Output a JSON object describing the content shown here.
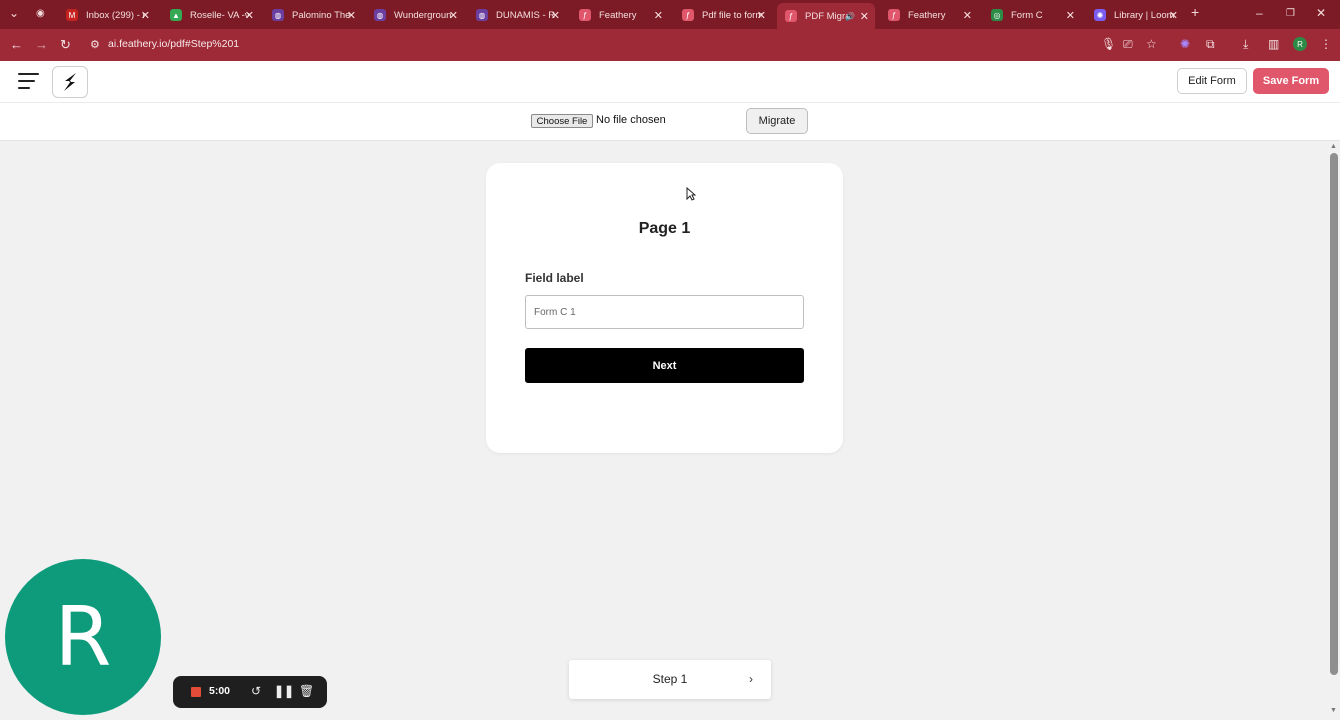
{
  "browser": {
    "tabs": [
      {
        "title": "Inbox (299) - r",
        "icon": "gmail-icon",
        "color": "#c5221f"
      },
      {
        "title": "Roselle- VA -v",
        "icon": "drive-icon",
        "color": "#34a853"
      },
      {
        "title": "Palomino The",
        "icon": "site-icon",
        "color": "#6b3fa0"
      },
      {
        "title": "Wundergroun",
        "icon": "site-icon",
        "color": "#6b3fa0"
      },
      {
        "title": "DUNAMIS - R",
        "icon": "site-icon",
        "color": "#6b3fa0"
      },
      {
        "title": "Feathery",
        "icon": "feathery-icon",
        "color": "#e0566b"
      },
      {
        "title": "Pdf file to form",
        "icon": "feathery-icon",
        "color": "#e0566b"
      },
      {
        "title": "PDF Migra",
        "icon": "feathery-icon",
        "color": "#e0566b",
        "active": true
      },
      {
        "title": "Feathery",
        "icon": "feathery-icon",
        "color": "#e0566b"
      },
      {
        "title": "Form C",
        "icon": "globe-icon",
        "color": "#2c8b46"
      },
      {
        "title": "Library | Loom",
        "icon": "loom-icon",
        "color": "#7a5cf0"
      }
    ],
    "url": "ai.feathery.io/pdf#Step%201",
    "profile_initial": "R"
  },
  "app": {
    "edit_form_label": "Edit Form",
    "save_form_label": "Save Form",
    "accent_color": "#e0566b"
  },
  "file_bar": {
    "choose_file_label": "Choose File",
    "no_file_text": "No file chosen",
    "migrate_label": "Migrate"
  },
  "form": {
    "page_title": "Page 1",
    "field_label": "Field label",
    "field_placeholder": "Form C 1",
    "next_label": "Next"
  },
  "step_nav": {
    "label": "Step 1"
  },
  "recorder": {
    "avatar_initial": "R",
    "avatar_color": "#0e9b7c",
    "time": "5:00"
  }
}
